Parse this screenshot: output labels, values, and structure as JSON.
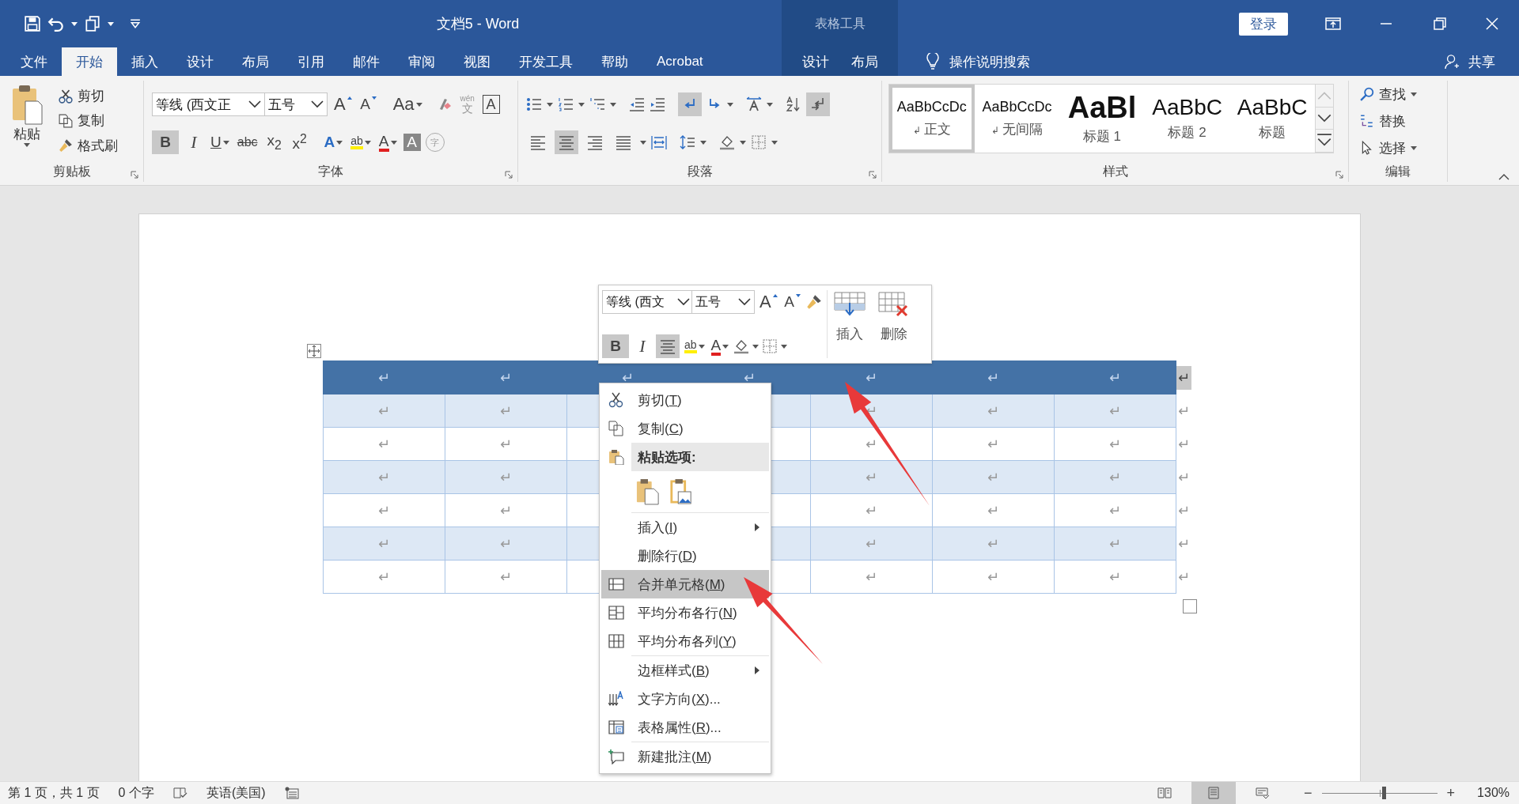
{
  "title_bar": {
    "title": "文档5  -  Word",
    "context_label": "表格工具",
    "login": "登录"
  },
  "tabs": [
    {
      "label": "文件",
      "selected": false
    },
    {
      "label": "开始",
      "selected": true
    },
    {
      "label": "插入",
      "selected": false
    },
    {
      "label": "设计",
      "selected": false
    },
    {
      "label": "布局",
      "selected": false
    },
    {
      "label": "引用",
      "selected": false
    },
    {
      "label": "邮件",
      "selected": false
    },
    {
      "label": "审阅",
      "selected": false
    },
    {
      "label": "视图",
      "selected": false
    },
    {
      "label": "开发工具",
      "selected": false
    },
    {
      "label": "帮助",
      "selected": false
    },
    {
      "label": "Acrobat",
      "selected": false
    }
  ],
  "context_tabs": [
    {
      "label": "设计",
      "selected": false
    },
    {
      "label": "布局",
      "selected": false
    }
  ],
  "tell_me": "操作说明搜索",
  "share": "共享",
  "ribbon": {
    "clipboard": {
      "paste": "粘贴",
      "cut": "剪切",
      "copy": "复制",
      "painter": "格式刷",
      "label": "剪贴板"
    },
    "font": {
      "name": "等线 (西文正",
      "size": "五号",
      "grow": "A",
      "shrink": "A",
      "case": "Aa",
      "phonetic_top": "wén",
      "phonetic": "文",
      "char_border": "A",
      "bold": {
        "label": "B",
        "selected": true
      },
      "italic": "I",
      "underline": "U",
      "strike": "abc",
      "subscript": "x$_{2}$",
      "superscript": "x$^{2}$",
      "effects": "A",
      "highlight": "ab",
      "font_color": "A",
      "shading": "A",
      "enclose": "字",
      "label": "字体"
    },
    "paragraph": {
      "label": "段落",
      "alignment": [
        {
          "selected": false
        },
        {
          "selected": true
        },
        {
          "selected": false
        },
        {
          "selected": false
        }
      ],
      "ltr": {
        "selected": true
      },
      "show_marks": {
        "selected": true
      }
    },
    "styles": {
      "label": "样式",
      "items": [
        {
          "kind": "body",
          "preview": "AaBbCcDc",
          "mark": "↲",
          "name": "正文",
          "selected": true
        },
        {
          "kind": "body",
          "preview": "AaBbCcDc",
          "mark": "↲",
          "name": "无间隔",
          "selected": false
        },
        {
          "kind": "heading1",
          "preview": "AaBl",
          "name": "标题 1",
          "selected": false
        },
        {
          "kind": "heading2",
          "preview": "AaBbC",
          "name": "标题 2",
          "selected": false
        },
        {
          "kind": "heading2",
          "preview": "AaBbC",
          "name": "标题",
          "selected": false
        }
      ]
    },
    "editing": {
      "label": "编辑",
      "find": "查找",
      "replace": "替换",
      "select": "选择"
    }
  },
  "table": {
    "rows": [
      {
        "selected": true,
        "shaded": false,
        "cells": [
          "↵",
          "↵",
          "↵",
          "↵",
          "↵",
          "↵",
          "↵"
        ],
        "end": "↵"
      },
      {
        "selected": false,
        "shaded": true,
        "cells": [
          "↵",
          "↵",
          null,
          null,
          "↵",
          "↵",
          "↵"
        ],
        "end": "↵"
      },
      {
        "selected": false,
        "shaded": false,
        "cells": [
          "↵",
          "↵",
          null,
          null,
          "↵",
          "↵",
          "↵"
        ],
        "end": "↵"
      },
      {
        "selected": false,
        "shaded": true,
        "cells": [
          "↵",
          "↵",
          null,
          null,
          "↵",
          "↵",
          "↵"
        ],
        "end": "↵"
      },
      {
        "selected": false,
        "shaded": false,
        "cells": [
          "↵",
          "↵",
          null,
          null,
          "↵",
          "↵",
          "↵"
        ],
        "end": "↵"
      },
      {
        "selected": false,
        "shaded": true,
        "cells": [
          "↵",
          "↵",
          null,
          null,
          "↵",
          "↵",
          "↵"
        ],
        "end": "↵"
      },
      {
        "selected": false,
        "shaded": false,
        "cells": [
          "↵",
          "↵",
          null,
          null,
          "↵",
          "↵",
          "↵"
        ],
        "end": "↵"
      }
    ]
  },
  "mini_toolbar": {
    "font": "等线 (西文",
    "size": "五号",
    "grow": "A",
    "shrink": "A",
    "bold": {
      "label": "B",
      "selected": true
    },
    "italic": "I",
    "center": {
      "selected": true
    },
    "highlight": "ab",
    "font_color": "A",
    "insert": "插入",
    "delete": "删除"
  },
  "context_menu": [
    {
      "kind": "item",
      "before": "剪切(",
      "key": "T",
      "after": ")",
      "selected": false,
      "submenu": false,
      "divider": false
    },
    {
      "kind": "item",
      "before": "复制(",
      "key": "C",
      "after": ")",
      "selected": false,
      "submenu": false,
      "divider": false
    },
    {
      "kind": "header",
      "label": "粘贴选项:",
      "divider": false
    },
    {
      "kind": "paste",
      "divider": false
    },
    {
      "kind": "item",
      "before": "插入(",
      "key": "I",
      "after": ")",
      "selected": false,
      "submenu": true,
      "divider": true
    },
    {
      "kind": "item",
      "before": "删除行(",
      "key": "D",
      "after": ")",
      "selected": false,
      "submenu": false,
      "divider": false
    },
    {
      "kind": "item",
      "before": "合并单元格(",
      "key": "M",
      "after": ")",
      "selected": true,
      "submenu": false,
      "divider": false
    },
    {
      "kind": "item",
      "before": "平均分布各行(",
      "key": "N",
      "after": ")",
      "selected": false,
      "submenu": false,
      "divider": false
    },
    {
      "kind": "item",
      "before": "平均分布各列(",
      "key": "Y",
      "after": ")",
      "selected": false,
      "submenu": false,
      "divider": false
    },
    {
      "kind": "item",
      "before": "边框样式(",
      "key": "B",
      "after": ")",
      "selected": false,
      "submenu": true,
      "divider": true
    },
    {
      "kind": "item",
      "before": "文字方向(",
      "key": "X",
      "after": ")...",
      "selected": false,
      "submenu": false,
      "divider": false
    },
    {
      "kind": "item",
      "before": "表格属性(",
      "key": "R",
      "after": ")...",
      "selected": false,
      "submenu": false,
      "divider": false
    },
    {
      "kind": "item",
      "before": "新建批注(",
      "key": "M",
      "after": ")",
      "selected": false,
      "submenu": false,
      "divider": true
    }
  ],
  "status_bar": {
    "page": "第 1 页，共 1 页",
    "words": "0 个字",
    "language": "英语(美国)",
    "views": [
      {
        "selected": false
      },
      {
        "selected": true
      },
      {
        "selected": false
      }
    ],
    "zoom_out": "−",
    "zoom": {
      "level": 0.54
    },
    "zoom_in": "+",
    "zoom_text": "130%"
  }
}
